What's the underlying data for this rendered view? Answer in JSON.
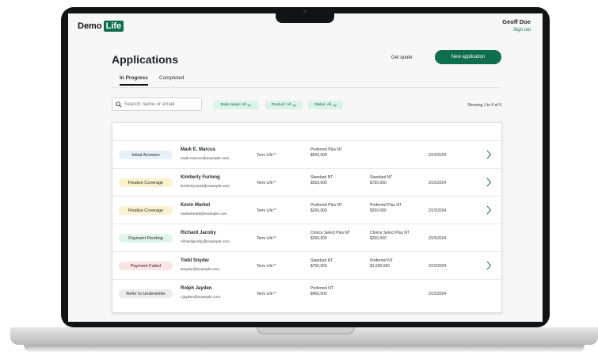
{
  "brand": {
    "prefix": "Demo",
    "highlight": "Life"
  },
  "user": {
    "name": "Geoff Doe",
    "signout": "Sign out"
  },
  "page": {
    "title": "Applications",
    "get_quote": "Get quote",
    "new_application": "New application"
  },
  "tabs": [
    {
      "label": "In Progress",
      "active": true
    },
    {
      "label": "Completed",
      "active": false
    }
  ],
  "search": {
    "placeholder": "Search name or email",
    "value": ""
  },
  "filters": [
    "Date range: All",
    "Product: All",
    "Status: All"
  ],
  "showing": "Showing 1 to 6 of 6",
  "colors": {
    "accent": "#0f6e4d",
    "filter_bg": "#d9f3e6"
  },
  "rows": [
    {
      "status": "Initial Answers",
      "status_color": "#e6f0fb",
      "name": "Mark E. Marcus",
      "email": "mark.marcus@example.com",
      "product": "Term Life℠",
      "col1": [
        "Preferred Plus NT",
        "$500,000"
      ],
      "col2": [
        "",
        ""
      ],
      "date": "2/15/2024",
      "chevron": true
    },
    {
      "status": "Finalize Coverage",
      "status_color": "#fbf1cf",
      "name": "Kimberly Furlong",
      "email": "kimberly1234@example.com",
      "product": "Term Life℠",
      "col1": [
        "Standard NT",
        "$500,000"
      ],
      "col2": [
        "Standard NT",
        "$750,000"
      ],
      "date": "2/15/2024",
      "chevron": true
    },
    {
      "status": "Finalize Coverage",
      "status_color": "#fbf1cf",
      "name": "Kevin Markel",
      "email": "markelmark@example.com",
      "product": "Term Life℠",
      "col1": [
        "Preferred Plus NT",
        "$200,000"
      ],
      "col2": [
        "Preferred Plus NT",
        "$200,000"
      ],
      "date": "2/15/2024",
      "chevron": true
    },
    {
      "status": "Payment Pending",
      "status_color": "#def5e8",
      "name": "Richard Jacoby",
      "email": "richardjacoby@example.com",
      "product": "Term Life℠",
      "col1": [
        "Choice Select Plus NT",
        "$200,000"
      ],
      "col2": [
        "Choice Select Plus NT",
        "$250,000"
      ],
      "date": "2/15/2024",
      "chevron": false
    },
    {
      "status": "Payment Failed",
      "status_color": "#fbe4e2",
      "name": "Todd Snyder",
      "email": "tsnyder@example.com",
      "product": "Term Life℠",
      "col1": [
        "Standard NT",
        "$750,000"
      ],
      "col2": [
        "Preferred NT",
        "$1,500,000"
      ],
      "date": "2/15/2024",
      "chevron": true
    },
    {
      "status": "Refer to Underwriter",
      "status_color": "#ececec",
      "name": "Rolph Jayden",
      "email": "r.jayden@example.com",
      "product": "Term Life℠",
      "col1": [
        "Preferred NT",
        "$450,000"
      ],
      "col2": [
        "",
        ""
      ],
      "date": "2/15/2024",
      "chevron": false
    }
  ]
}
